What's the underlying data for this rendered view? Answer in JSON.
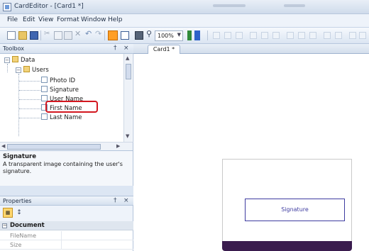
{
  "window": {
    "title": "CardEditor - [Card1 *]"
  },
  "menu": [
    "File",
    "Edit",
    "View",
    "Format",
    "Window",
    "Help"
  ],
  "toolbar": {
    "zoom_value": "100%"
  },
  "toolbox": {
    "title": "Toolbox",
    "pin_label": "†",
    "close_label": "×",
    "tree": {
      "data": "Data",
      "users": "Users",
      "items": [
        "Photo ID",
        "Signature",
        "User Name",
        "First Name",
        "Last Name"
      ]
    }
  },
  "description": {
    "title": "Signature",
    "text": "A transparent image containing the user's signature."
  },
  "properties": {
    "title": "Properties",
    "pin_label": "†",
    "close_label": "×",
    "category": "Document",
    "rows": [
      "FileName",
      "Size"
    ]
  },
  "document": {
    "tab": "Card1 *",
    "field_label": "Signature"
  },
  "colors": {
    "highlight": "#d3171f",
    "card_band": "#3a1c4e",
    "field_border": "#3e3ca0"
  }
}
